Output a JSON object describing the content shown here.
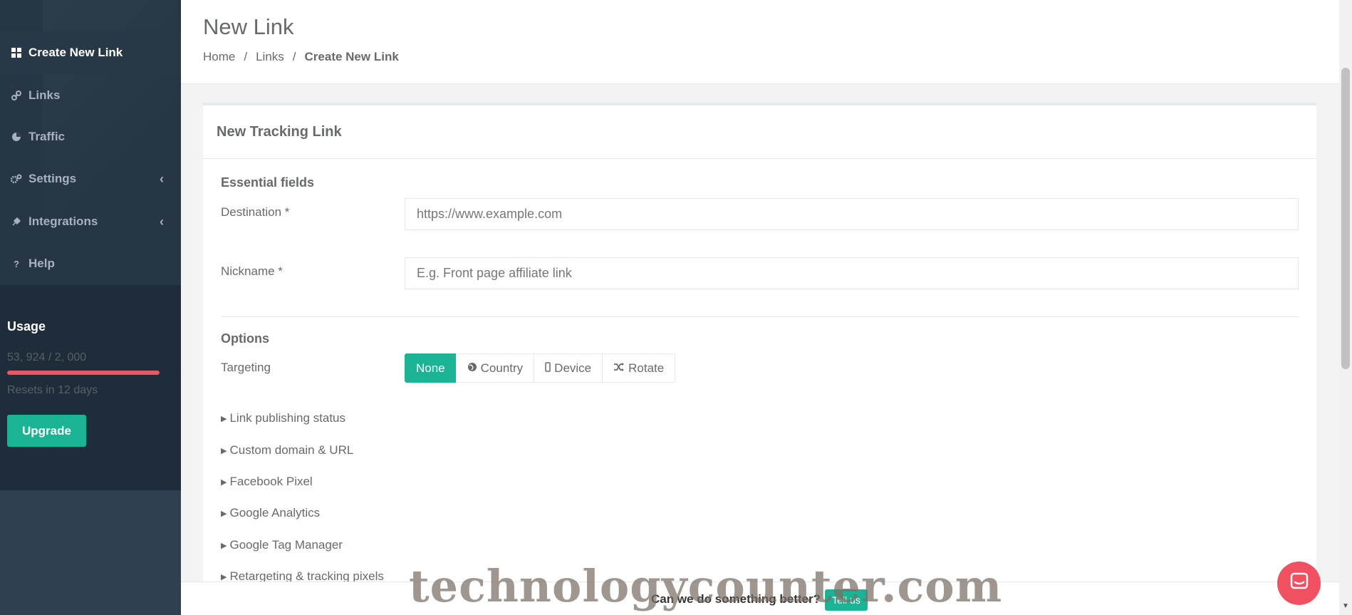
{
  "sidebar": {
    "items": [
      {
        "label": "Create New Link",
        "icon": "grid-icon"
      },
      {
        "label": "Links",
        "icon": "link-icon"
      },
      {
        "label": "Traffic",
        "icon": "pie-chart-icon"
      },
      {
        "label": "Settings",
        "icon": "gears-icon"
      },
      {
        "label": "Integrations",
        "icon": "plug-icon"
      },
      {
        "label": "Help",
        "icon": "question-icon"
      }
    ],
    "usage": {
      "title": "Usage",
      "count": "53, 924 / 2, 000",
      "progress_fraction": 1.0,
      "resets": "Resets in 12 days",
      "upgrade_label": "Upgrade"
    }
  },
  "header": {
    "title": "New Link",
    "breadcrumb": [
      "Home",
      "Links",
      "Create New Link"
    ]
  },
  "panel": {
    "title": "New Tracking Link",
    "essential_heading": "Essential fields",
    "destination_label": "Destination *",
    "destination_placeholder": "https://www.example.com",
    "nickname_label": "Nickname *",
    "nickname_placeholder": "E.g. Front page affiliate link",
    "options_heading": "Options",
    "targeting_label": "Targeting",
    "targeting_options": [
      "None",
      "Country",
      "Device",
      "Rotate"
    ],
    "collapsibles": [
      "Link publishing status",
      "Custom domain & URL",
      "Facebook Pixel",
      "Google Analytics",
      "Google Tag Manager",
      "Retargeting & tracking pixels"
    ]
  },
  "feedback": {
    "message": "Can we do something better?",
    "button_label": "Tell us"
  },
  "watermark": "technologycounter.com",
  "colors": {
    "accent": "#1ab394",
    "sidebar": "#2f4050",
    "usage_bar": "#ed5565",
    "chat": "#f05060"
  }
}
